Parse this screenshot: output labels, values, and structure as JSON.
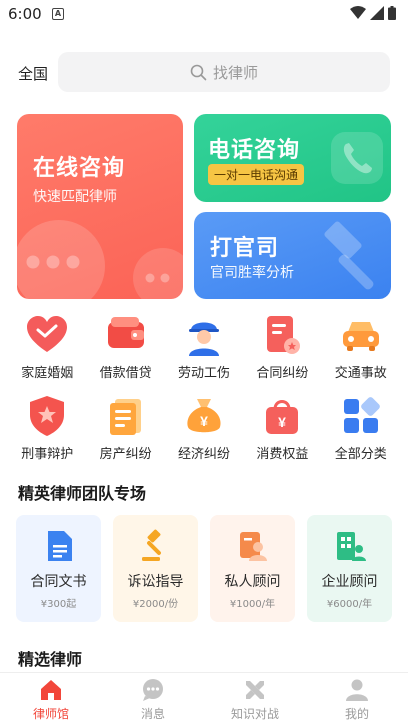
{
  "status_bar": {
    "time": "6:00",
    "notification_glyph": "A"
  },
  "search": {
    "city": "全国",
    "placeholder": "找律师"
  },
  "banners": {
    "online": {
      "title": "在线咨询",
      "subtitle": "快速匹配律师",
      "color": "#fb6356"
    },
    "phone": {
      "title": "电话咨询",
      "tag": "一对一电话沟通",
      "color": "#21c486"
    },
    "lawsuit": {
      "title": "打官司",
      "subtitle": "官司胜率分析",
      "color": "#3b82f0"
    }
  },
  "categories": [
    {
      "label": "家庭婚姻",
      "icon": "heart-icon"
    },
    {
      "label": "借款借贷",
      "icon": "wallet-icon"
    },
    {
      "label": "劳动工伤",
      "icon": "worker-icon"
    },
    {
      "label": "合同纠纷",
      "icon": "contract-icon"
    },
    {
      "label": "交通事故",
      "icon": "car-icon"
    },
    {
      "label": "刑事辩护",
      "icon": "shield-icon"
    },
    {
      "label": "房产纠纷",
      "icon": "document-icon"
    },
    {
      "label": "经济纠纷",
      "icon": "money-bag-icon"
    },
    {
      "label": "消费权益",
      "icon": "shopping-bag-icon"
    },
    {
      "label": "全部分类",
      "icon": "grid-icon"
    }
  ],
  "team_section": {
    "title": "精英律师团队专场"
  },
  "team_cards": [
    {
      "name": "合同文书",
      "price": "¥300起",
      "icon": "file-icon",
      "bg": "#eef4ff"
    },
    {
      "name": "诉讼指导",
      "price": "¥2000/份",
      "icon": "gavel-icon",
      "bg": "#fff6e8"
    },
    {
      "name": "私人顾问",
      "price": "¥1000/年",
      "icon": "person-card-icon",
      "bg": "#fff3ec"
    },
    {
      "name": "企业顾问",
      "price": "¥6000/年",
      "icon": "building-icon",
      "bg": "#eaf8f2"
    }
  ],
  "lawyers_section": {
    "title": "精选律师"
  },
  "tabs": [
    {
      "label": "律师馆",
      "icon": "home-icon",
      "active": true
    },
    {
      "label": "消息",
      "icon": "message-icon",
      "active": false
    },
    {
      "label": "知识对战",
      "icon": "battle-icon",
      "active": false
    },
    {
      "label": "我的",
      "icon": "profile-icon",
      "active": false
    }
  ],
  "colors": {
    "accent": "#f2463a"
  }
}
